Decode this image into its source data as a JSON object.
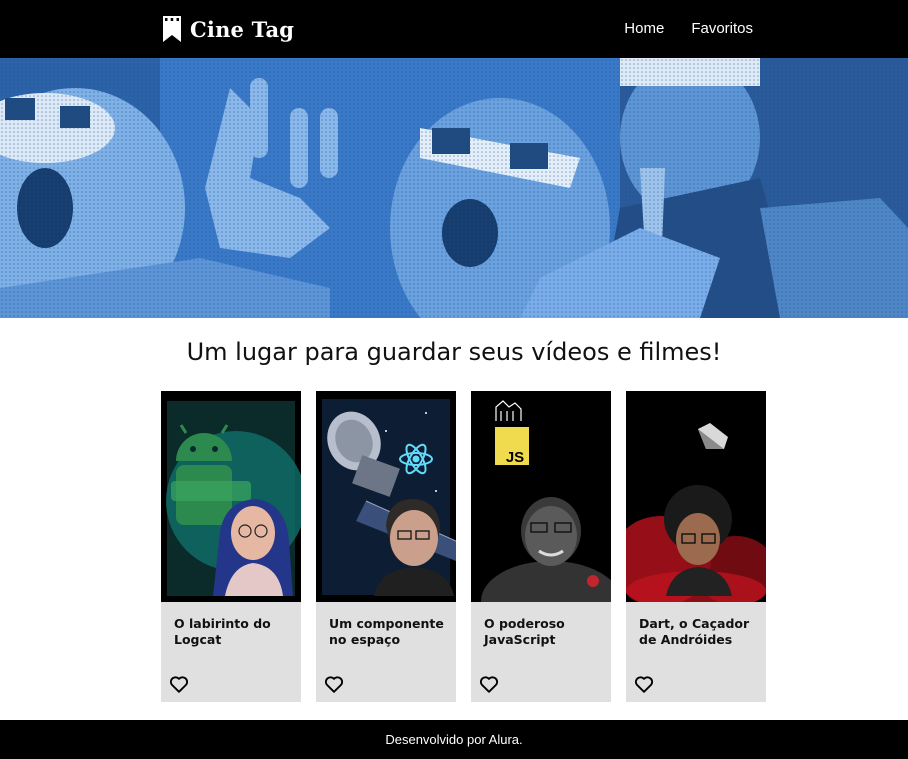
{
  "header": {
    "logo_text": "Cine Tag",
    "logo_icon": "bookmark-film-icon",
    "nav": [
      {
        "label": "Home"
      },
      {
        "label": "Favoritos"
      }
    ]
  },
  "banner": {
    "tint_color": "#3d7fd0"
  },
  "main": {
    "title": "Um lugar para guardar seus vídeos e filmes!"
  },
  "cards": [
    {
      "title": "O labirinto do Logcat",
      "favorite_icon": "heart-outline-icon"
    },
    {
      "title": "Um componente no espaço",
      "favorite_icon": "heart-outline-icon"
    },
    {
      "title": "O poderoso JavaScript",
      "favorite_icon": "heart-outline-icon",
      "badge": "JS"
    },
    {
      "title": "Dart, o Caçador de Andróides",
      "favorite_icon": "heart-outline-icon"
    }
  ],
  "footer": {
    "text": "Desenvolvido por Alura."
  }
}
